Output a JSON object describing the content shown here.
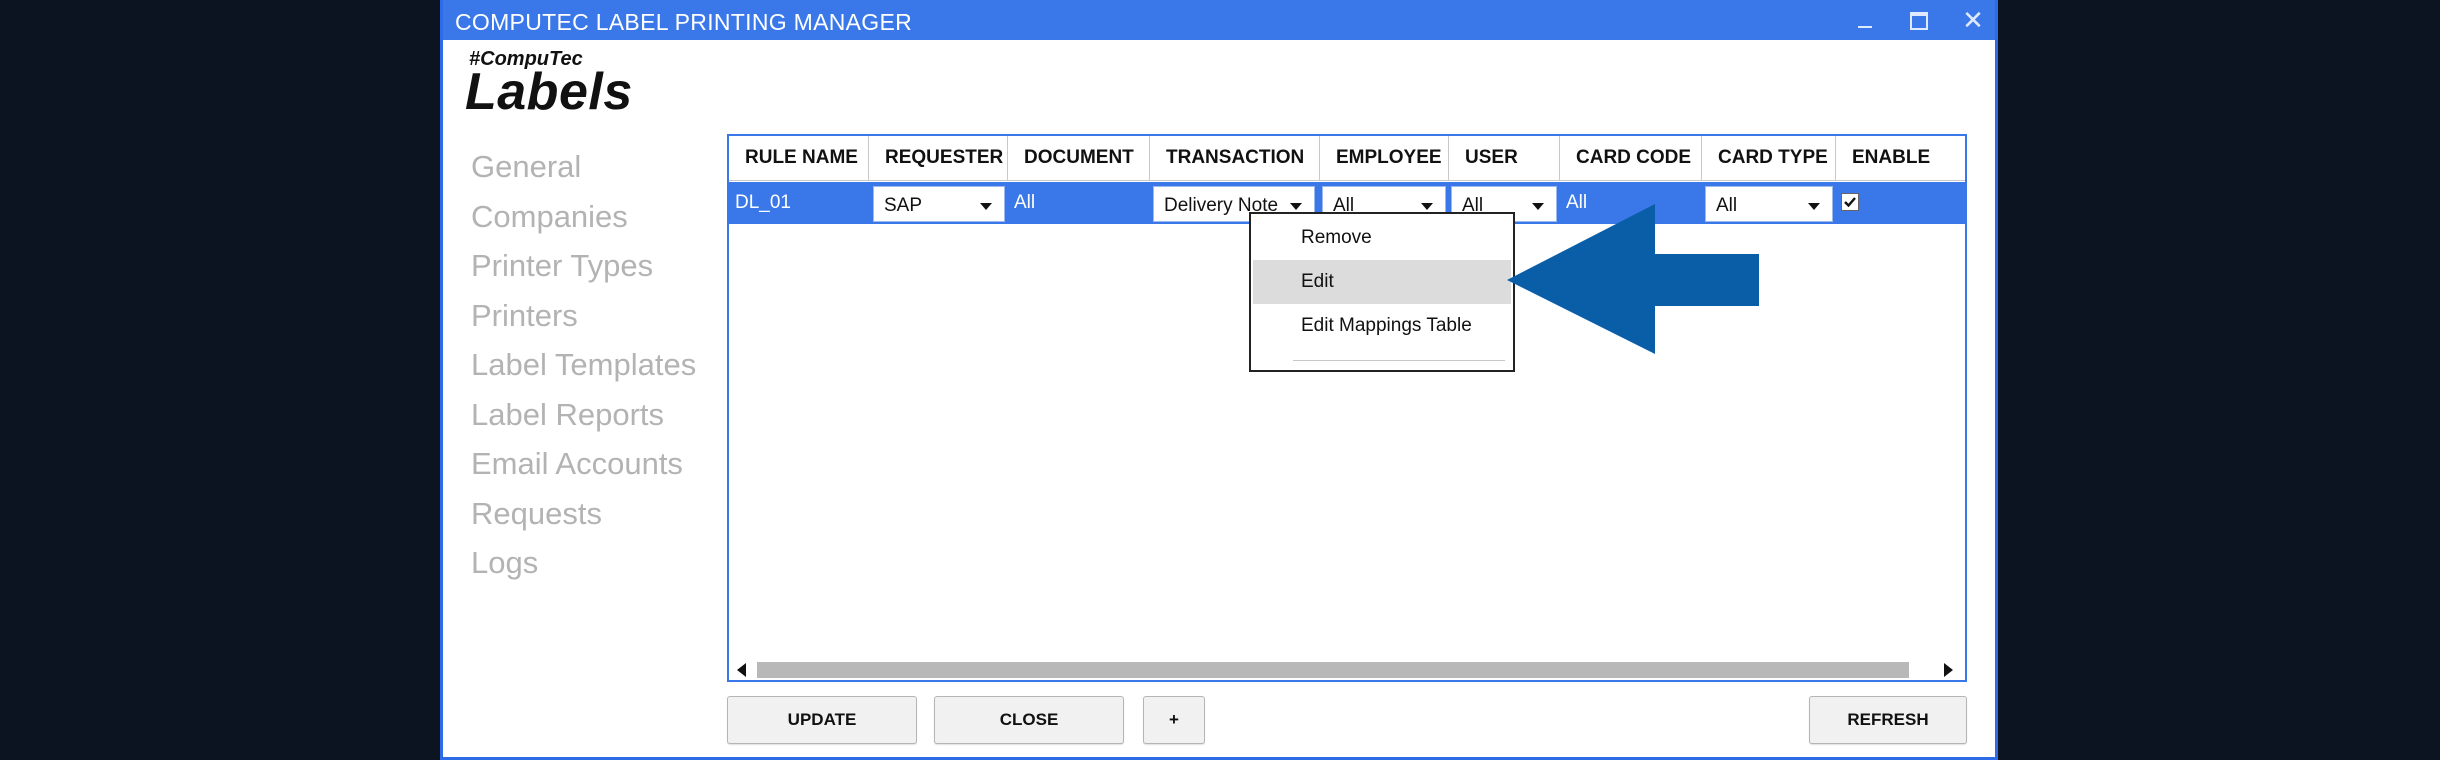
{
  "window": {
    "title": "COMPUTEC LABEL PRINTING MANAGER"
  },
  "logo": {
    "small": "#CompuTec",
    "big": "Labels"
  },
  "nav": {
    "items": [
      {
        "label": "General"
      },
      {
        "label": "Companies"
      },
      {
        "label": "Printer Types"
      },
      {
        "label": "Printers"
      },
      {
        "label": "Label Templates"
      },
      {
        "label": "Label Reports"
      },
      {
        "label": "Email Accounts"
      },
      {
        "label": "Requests"
      },
      {
        "label": "Logs"
      }
    ]
  },
  "grid": {
    "columns": [
      "RULE NAME",
      "REQUESTER",
      "DOCUMENT",
      "TRANSACTION",
      "EMPLOYEE",
      "USER",
      "CARD CODE",
      "CARD TYPE",
      "ENABLE"
    ],
    "row": {
      "rule_name": "DL_01",
      "requester": "SAP",
      "document": "All",
      "transaction": "Delivery Note",
      "employee": "All",
      "user": "All",
      "card_code": "All",
      "card_type": "All",
      "enable": true
    }
  },
  "context_menu": {
    "items": [
      {
        "label": "Remove"
      },
      {
        "label": "Edit",
        "highlighted": true
      },
      {
        "label": "Edit Mappings Table"
      }
    ]
  },
  "buttons": {
    "update": "UPDATE",
    "close": "CLOSE",
    "add": "+",
    "refresh": "REFRESH"
  },
  "colors": {
    "accent": "#3a78ea",
    "annotation_arrow": "#0a5ea8"
  }
}
